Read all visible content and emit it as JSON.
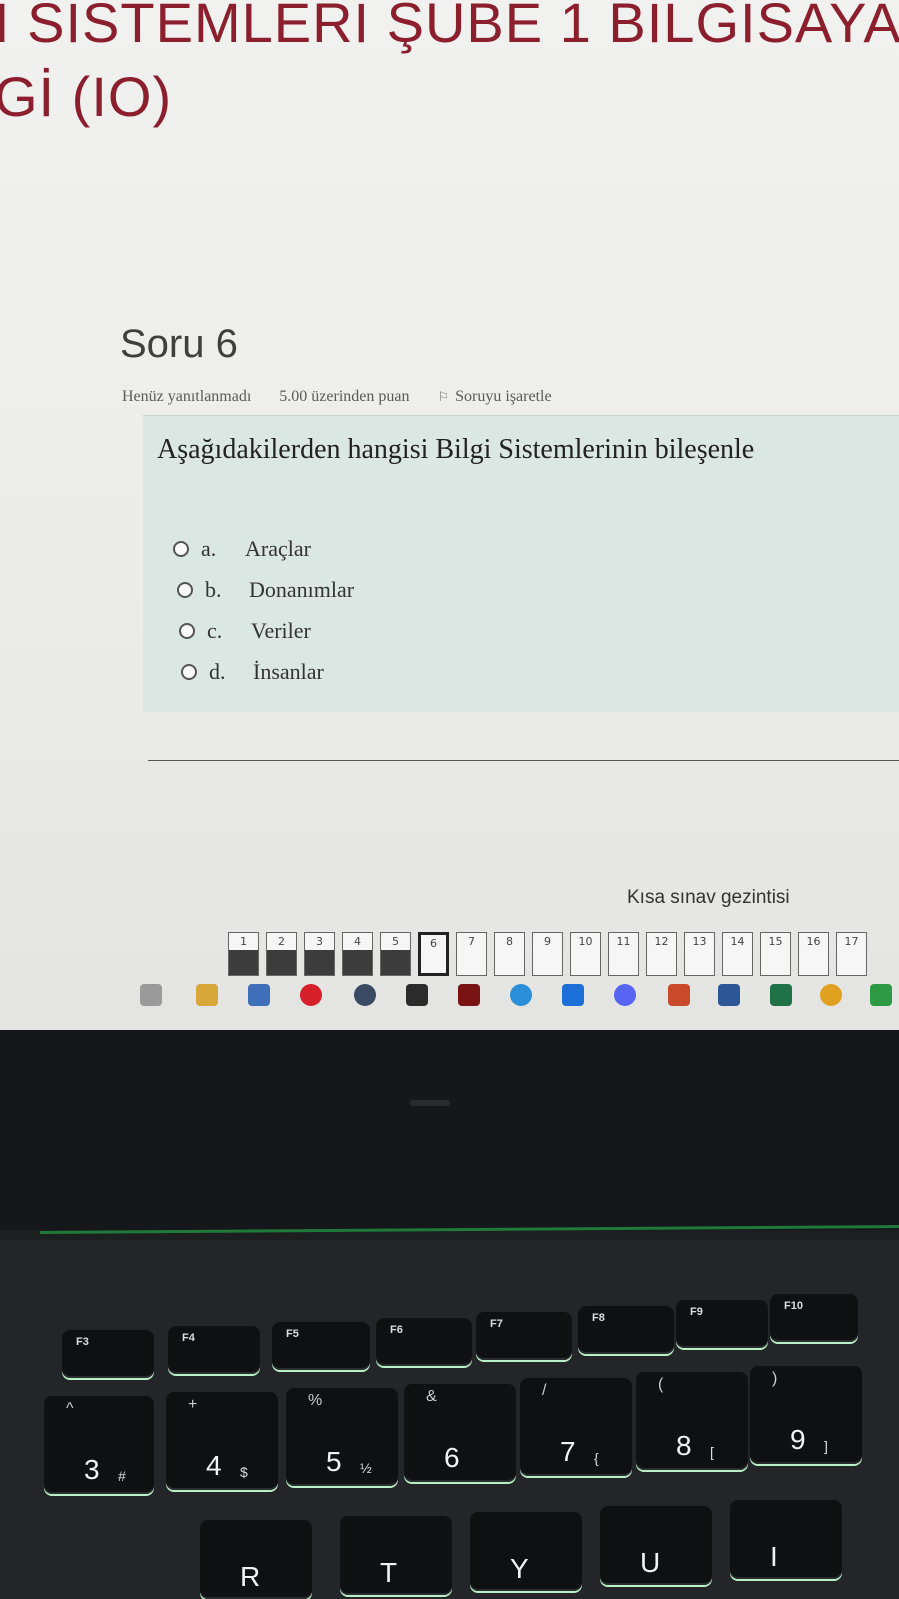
{
  "header": {
    "course_title_line1": "I SİSTEMLERİ ŞUBE 1 BİLGİSAYA",
    "course_title_line2": "Gİ (IO)"
  },
  "question": {
    "heading": "Soru 6",
    "status": "Henüz yanıtlanmadı",
    "points": "5.00 üzerinden puan",
    "flag_label": "Soruyu işaretle",
    "text": "Aşağıdakilerden hangisi Bilgi Sistemlerinin bileşenle",
    "answers": [
      {
        "letter": "a.",
        "label": "Araçlar"
      },
      {
        "letter": "b.",
        "label": "Donanımlar"
      },
      {
        "letter": "c.",
        "label": "Veriler"
      },
      {
        "letter": "d.",
        "label": "İnsanlar"
      }
    ]
  },
  "quiz_nav": {
    "title": "Kısa sınav gezintisi",
    "buttons": [
      "1",
      "2",
      "3",
      "4",
      "5",
      "6",
      "7",
      "8",
      "9",
      "10",
      "11",
      "12",
      "13",
      "14",
      "15",
      "16",
      "17"
    ],
    "answered_count": 5,
    "current": "6"
  },
  "taskbar": {
    "icons": [
      "task-view-icon",
      "file-explorer-icon",
      "mail-icon",
      "pinterest-icon",
      "cube-app-icon",
      "terminal-icon",
      "red-app-icon",
      "telegram-icon",
      "teamviewer-icon",
      "discord-icon",
      "powerpoint-icon",
      "word-icon",
      "excel-icon",
      "chrome-icon",
      "green-app-icon"
    ]
  },
  "keyboard": {
    "fn_keys": [
      {
        "label": "F3"
      },
      {
        "label": "F4"
      },
      {
        "label": "F5"
      },
      {
        "label": "F6"
      },
      {
        "label": "F7"
      },
      {
        "label": "F8"
      },
      {
        "label": "F9"
      },
      {
        "label": "F10"
      }
    ],
    "number_keys": [
      {
        "main": "3",
        "top": "^",
        "sub": "#"
      },
      {
        "main": "4",
        "top": "+",
        "sub": "$"
      },
      {
        "main": "5",
        "top": "%",
        "sub": "½"
      },
      {
        "main": "6",
        "top": "&",
        "sub": ""
      },
      {
        "main": "7",
        "top": "/",
        "sub": "{"
      },
      {
        "main": "8",
        "top": "(",
        "sub": "["
      },
      {
        "main": "9",
        "top": ")",
        "sub": "]"
      }
    ],
    "letter_keys": [
      "R",
      "T",
      "Y",
      "U",
      "I"
    ]
  }
}
